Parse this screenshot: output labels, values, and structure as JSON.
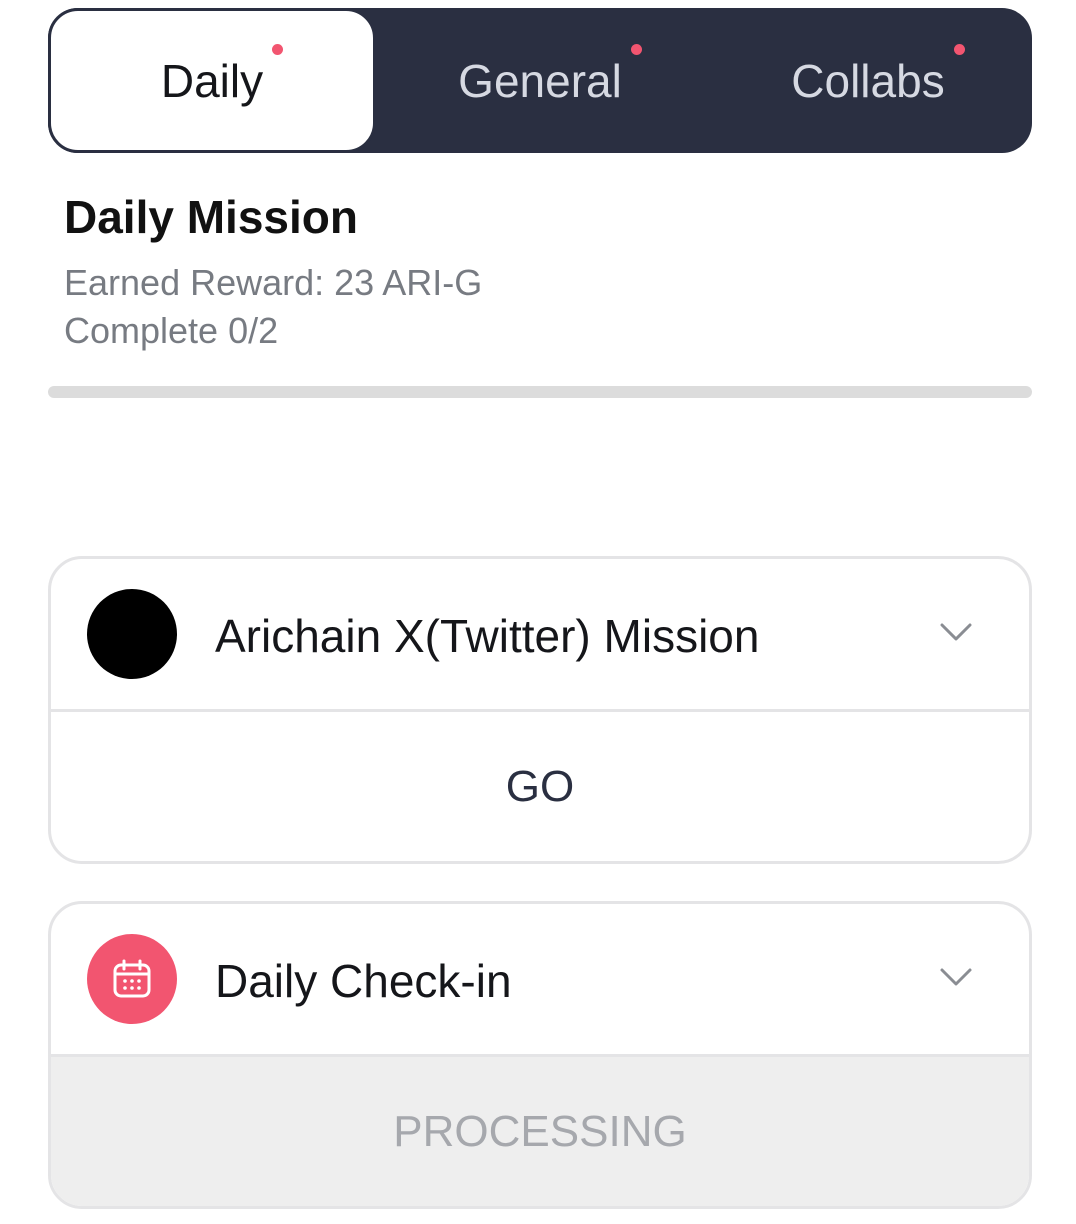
{
  "tabs": [
    {
      "label": "Daily",
      "active": true,
      "has_dot": true
    },
    {
      "label": "General",
      "active": false,
      "has_dot": true
    },
    {
      "label": "Collabs",
      "active": false,
      "has_dot": true
    }
  ],
  "summary": {
    "title": "Daily Mission",
    "earned_reward": "Earned Reward: 23 ARI-G",
    "complete": "Complete 0/2",
    "progress_fraction": 0
  },
  "missions": [
    {
      "title": "Arichain X(Twitter) Mission",
      "icon": "x-twitter-icon",
      "action_label": "GO",
      "action_state": "enabled"
    },
    {
      "title": "Daily Check-in",
      "icon": "calendar-icon",
      "action_label": "PROCESSING",
      "action_state": "disabled"
    }
  ],
  "colors": {
    "tabbar_bg": "#2a2f41",
    "notification_dot": "#f25570",
    "checkin_icon_bg": "#f25570",
    "processing_bg": "#eeeeee"
  }
}
